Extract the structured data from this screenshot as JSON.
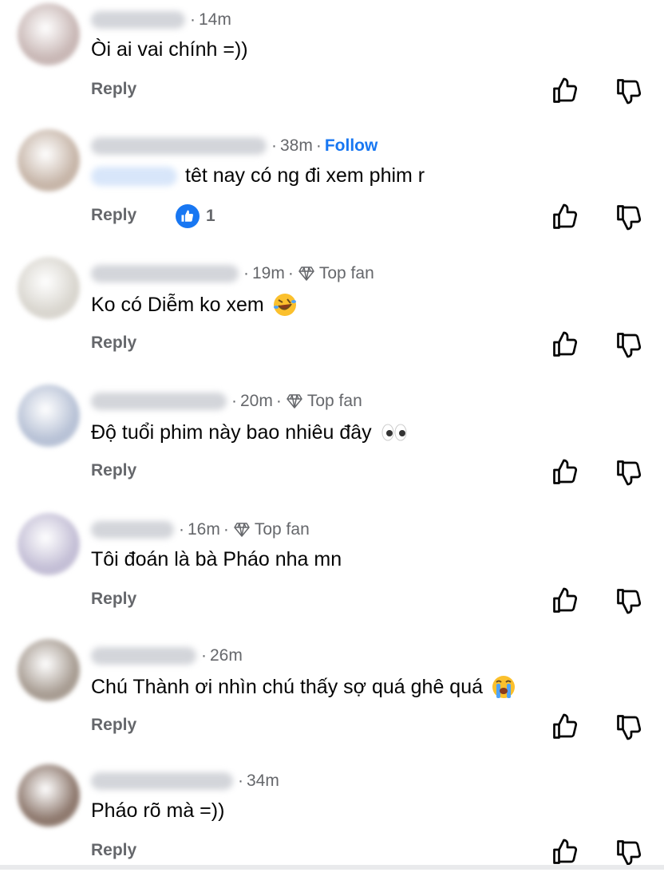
{
  "comments": [
    {
      "time": "14m",
      "follow": "",
      "badge": "",
      "text": "Òi ai vai chính =))",
      "reply": "Reply",
      "likes": "",
      "emoji": "",
      "avatar_color": "#c9b8b6",
      "name_width": 118
    },
    {
      "time": "38m",
      "follow": "Follow",
      "badge": "",
      "text": "têt nay có ng đi xem phim r",
      "reply": "Reply",
      "likes": "1",
      "emoji": "",
      "avatar_color": "#c7b6a9",
      "name_width": 220
    },
    {
      "time": "19m",
      "follow": "",
      "badge": "Top fan",
      "text": "Ko có Diễm ko xem",
      "reply": "Reply",
      "likes": "",
      "emoji": "rolling-laughing-emoji",
      "avatar_color": "#d9d6cf",
      "name_width": 185
    },
    {
      "time": "20m",
      "follow": "",
      "badge": "Top fan",
      "text": "Độ tuổi phim này bao nhiêu đây",
      "reply": "Reply",
      "likes": "",
      "emoji": "eyes-emoji",
      "avatar_color": "#b8c2d6",
      "name_width": 170
    },
    {
      "time": "16m",
      "follow": "",
      "badge": "Top fan",
      "text": "Tôi đoán là bà Pháo nha mn",
      "reply": "Reply",
      "likes": "",
      "emoji": "",
      "avatar_color": "#c4bfd6",
      "name_width": 104
    },
    {
      "time": "26m",
      "follow": "",
      "badge": "",
      "text": "Chú Thành ơi nhìn chú thấy sợ quá ghê quá",
      "reply": "Reply",
      "likes": "",
      "emoji": "crying-emoji",
      "avatar_color": "#a89d93",
      "name_width": 132
    },
    {
      "time": "34m",
      "follow": "",
      "badge": "",
      "text": "Pháo rõ mà =))",
      "reply": "Reply",
      "likes": "",
      "emoji": "",
      "avatar_color": "#8f7a6f",
      "name_width": 178
    }
  ],
  "colors": {
    "accent": "#1877f2",
    "meta": "#65676b",
    "text": "#050505"
  }
}
